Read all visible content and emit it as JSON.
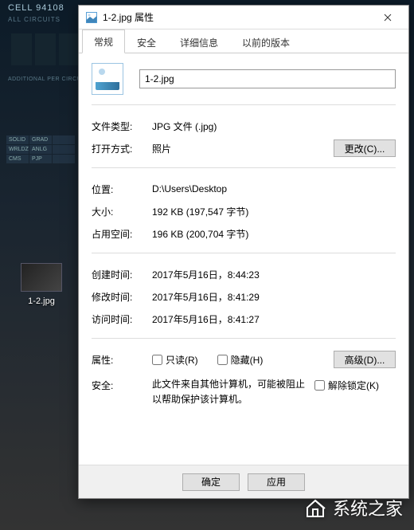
{
  "background": {
    "cell_label": "CELL 94108",
    "circuits_label": "ALL CIRCUITS",
    "additional_label": "ADDITIONAL PER CIRCUIT ON",
    "grid": [
      "SOLID",
      "GRAD",
      "",
      "WRLDZ",
      "ANLG",
      "",
      "CMS",
      "PJP",
      ""
    ]
  },
  "desktop_icon": {
    "label": "1-2.jpg"
  },
  "dialog": {
    "title": "1-2.jpg 属性",
    "tabs": [
      {
        "label": "常规",
        "active": true
      },
      {
        "label": "安全"
      },
      {
        "label": "详细信息"
      },
      {
        "label": "以前的版本"
      }
    ],
    "filename": "1-2.jpg",
    "labels": {
      "filetype": "文件类型:",
      "openwith": "打开方式:",
      "location": "位置:",
      "size": "大小:",
      "sizeondisk": "占用空间:",
      "created": "创建时间:",
      "modified": "修改时间:",
      "accessed": "访问时间:",
      "attributes": "属性:",
      "security": "安全:"
    },
    "values": {
      "filetype": "JPG 文件 (.jpg)",
      "openwith": "照片",
      "location": "D:\\Users\\Desktop",
      "size": "192 KB (197,547 字节)",
      "sizeondisk": "196 KB (200,704 字节)",
      "created": "2017年5月16日，8:44:23",
      "modified": "2017年5月16日，8:41:29",
      "accessed": "2017年5月16日，8:41:27",
      "security_text": "此文件来自其他计算机，可能被阻止以帮助保护该计算机。"
    },
    "buttons": {
      "change": "更改(C)...",
      "advanced": "高级(D)...",
      "ok": "确定",
      "apply": "应用"
    },
    "checkboxes": {
      "readonly": "只读(R)",
      "hidden": "隐藏(H)",
      "unblock": "解除锁定(K)"
    }
  },
  "watermark": {
    "text": "系统之家"
  }
}
